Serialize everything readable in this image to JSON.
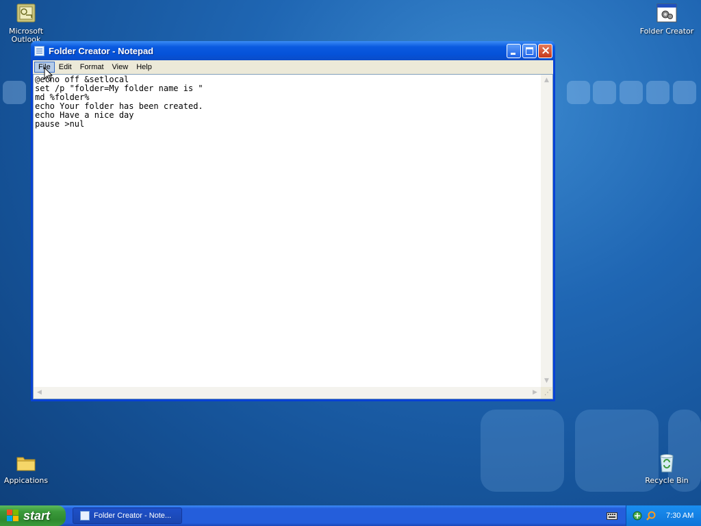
{
  "desktop": {
    "icons": [
      {
        "label_line1": "Microsoft",
        "label_line2": "Outlook"
      },
      {
        "label": "Folder Creator"
      },
      {
        "label": "Appications"
      },
      {
        "label": "Recycle Bin"
      }
    ]
  },
  "window": {
    "title": "Folder Creator - Notepad",
    "menu": [
      "File",
      "Edit",
      "Format",
      "View",
      "Help"
    ],
    "active_menu": "File",
    "content_lines": [
      "@echo off &setlocal",
      "set /p \"folder=My folder name is \"",
      "md %folder%",
      "echo Your folder has been created.",
      "echo Have a nice day",
      "pause >nul"
    ]
  },
  "taskbar": {
    "start_label": "start",
    "task_button_label": "Folder Creator - Note...",
    "clock": "7:30 AM"
  },
  "colors": {
    "titlebar": "#0a5ae0",
    "start_green": "#3a9a3a",
    "taskbar_blue": "#245edb"
  }
}
